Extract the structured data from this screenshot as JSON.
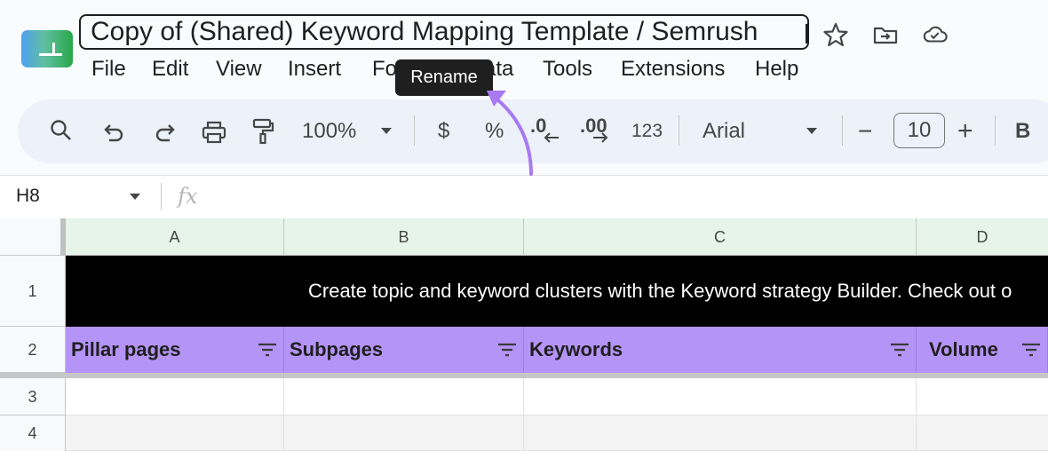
{
  "document": {
    "title": "Copy of (Shared) Keyword Mapping Template / Semrush"
  },
  "menu": [
    "File",
    "Edit",
    "View",
    "Insert",
    "Fo",
    "ata",
    "Tools",
    "Extensions",
    "Help"
  ],
  "tooltip": {
    "text": "Rename"
  },
  "toolbar": {
    "zoom": "100%",
    "currency": "$",
    "percent": "%",
    "decrease_decimal": ".0",
    "increase_decimal": ".00",
    "number_format": "123",
    "font": "Arial",
    "font_size": "10",
    "minus": "−",
    "plus": "+",
    "bold": "B"
  },
  "formula_bar": {
    "name_box": "H8",
    "fx": "fx"
  },
  "grid": {
    "columns": [
      "A",
      "B",
      "C",
      "D"
    ],
    "rows": [
      "1",
      "2",
      "3",
      "4"
    ],
    "banner": "Create topic and keyword clusters with the Keyword strategy Builder. Check out o",
    "headers": [
      "Pillar pages",
      "Subpages",
      "Keywords",
      "Volume"
    ]
  },
  "colors": {
    "header_fill": "#b594f7",
    "banner_fill": "#000000",
    "arrow": "#a879f0",
    "selected_col_header": "#e6f4ea"
  }
}
